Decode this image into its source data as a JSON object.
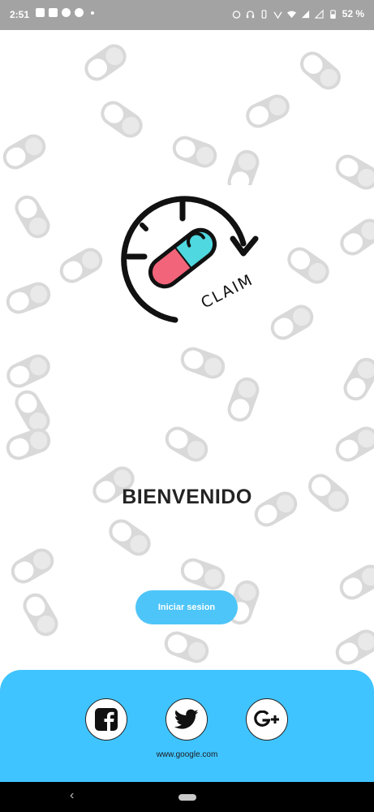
{
  "status_bar": {
    "time": "2:51",
    "battery": "52 %"
  },
  "logo": {
    "text": "CLAIM",
    "pill_colors": {
      "top": "#4fd8e0",
      "bottom": "#f2647a"
    }
  },
  "welcome": {
    "title": "BIENVENIDO"
  },
  "login_button": {
    "label": "Iniciar sesion"
  },
  "social": {
    "icons": [
      "facebook-icon",
      "twitter-icon",
      "google-plus-icon"
    ],
    "link": "www.google.com"
  },
  "colors": {
    "accent": "#40c4ff",
    "button": "#4ec5f8",
    "pattern": "#d9d9d9",
    "status_bar": "#a3a3a3"
  }
}
